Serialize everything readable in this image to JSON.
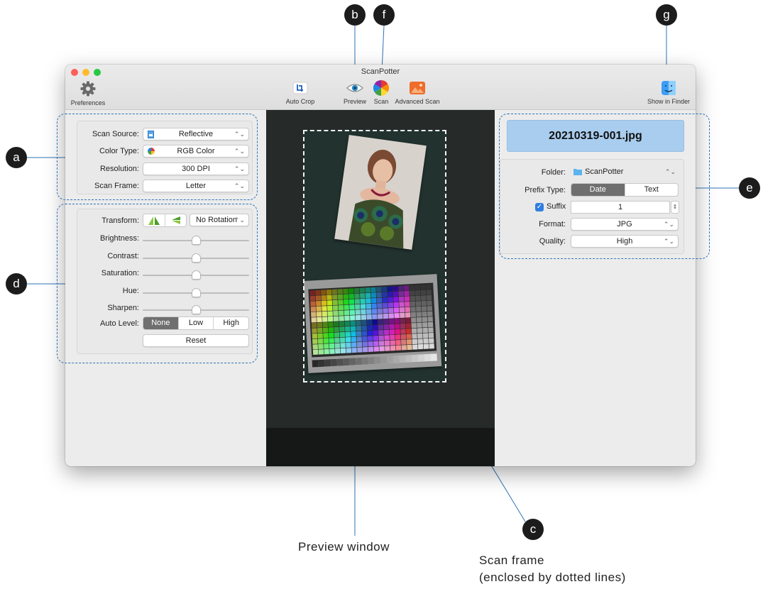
{
  "window": {
    "title": "ScanPotter",
    "traffic_colors": [
      "#ff5f57",
      "#febc2e",
      "#28c840"
    ]
  },
  "toolbar": {
    "preferences_label": "Preferences",
    "auto_crop_label": "Auto Crop",
    "preview_label": "Preview",
    "scan_label": "Scan",
    "advanced_scan_label": "Advanced Scan",
    "show_in_finder_label": "Show in Finder"
  },
  "scan_settings": {
    "source_label": "Scan Source:",
    "source_value": "Reflective",
    "color_type_label": "Color Type:",
    "color_type_value": "RGB Color",
    "resolution_label": "Resolution:",
    "resolution_value": "300 DPI",
    "scan_frame_label": "Scan Frame:",
    "scan_frame_value": "Letter"
  },
  "adjustments": {
    "transform_label": "Transform:",
    "rotation_value": "No Rotation",
    "sliders": [
      {
        "label": "Brightness:",
        "value": 0.5
      },
      {
        "label": "Contrast:",
        "value": 0.5
      },
      {
        "label": "Saturation:",
        "value": 0.5
      },
      {
        "label": "Hue:",
        "value": 0.5
      },
      {
        "label": "Sharpen:",
        "value": 0.5
      }
    ],
    "auto_level_label": "Auto Level:",
    "auto_level_options": [
      "None",
      "Low",
      "High"
    ],
    "auto_level_selected": "None",
    "reset_label": "Reset"
  },
  "output": {
    "filename": "20210319-001.jpg",
    "folder_label": "Folder:",
    "folder_value": "ScanPotter",
    "prefix_label": "Prefix Type:",
    "prefix_options": [
      "Date",
      "Text"
    ],
    "prefix_selected": "Date",
    "suffix_label": "Suffix",
    "suffix_checked": true,
    "suffix_value": "1",
    "format_label": "Format:",
    "format_value": "JPG",
    "quality_label": "Quality:",
    "quality_value": "High"
  },
  "callouts": {
    "a": "a",
    "b": "b",
    "c": "c",
    "d": "d",
    "e": "e",
    "f": "f",
    "g": "g"
  },
  "captions": {
    "preview_window": "Preview window",
    "scan_frame_line1": "Scan frame",
    "scan_frame_line2": "(enclosed by dotted lines)"
  },
  "colors": {
    "callout_line": "#2d74b6",
    "filename_bg": "#a9cdee",
    "selected_segment": "#6f6f6f",
    "checkbox": "#2f7ee0"
  }
}
